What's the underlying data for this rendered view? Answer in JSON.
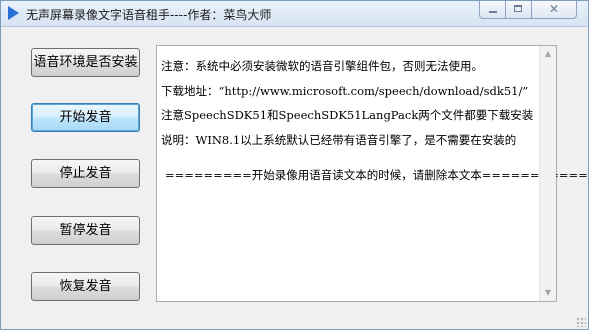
{
  "window": {
    "title": "无声屏幕录像文字语音租手----作者：菜鸟大师",
    "controls": {
      "minimize": "minimize",
      "maximize": "maximize",
      "close": "✕"
    }
  },
  "buttons": {
    "check_env": "语音环境是否安装",
    "start": "开始发音",
    "stop": "停止发音",
    "pause": "暂停发音",
    "resume": "恢复发音"
  },
  "textbox": {
    "lines": [
      "注意：系统中必须安装微软的语音引擎组件包，否则无法使用。",
      "下载地址：“http://www.microsoft.com/speech/download/sdk51/”",
      "注意SpeechSDK51和SpeechSDK51LangPack两个文件都要下载安装",
      "说明：WIN8.1以上系统默认已经带有语音引擎了，是不需要在安装的",
      "=========开始录像用语音读文本的时候，请删除本文本============"
    ]
  },
  "scrollbar": {
    "up_icon": "▲",
    "down_icon": "▼"
  }
}
